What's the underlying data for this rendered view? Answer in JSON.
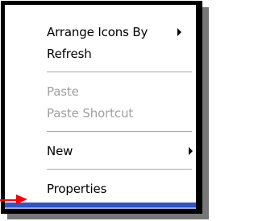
{
  "context_menu": {
    "items": [
      {
        "label": "Arrange Icons By",
        "has_submenu": true,
        "enabled": true
      },
      {
        "label": "Refresh",
        "has_submenu": false,
        "enabled": true
      },
      {
        "label": "Paste",
        "has_submenu": false,
        "enabled": false
      },
      {
        "label": "Paste Shortcut",
        "has_submenu": false,
        "enabled": false
      },
      {
        "label": "New",
        "has_submenu": true,
        "enabled": true
      },
      {
        "label": "Properties",
        "has_submenu": false,
        "enabled": true
      }
    ]
  },
  "colors": {
    "frame": "#000000",
    "menu_accent": "#2f55c8",
    "disabled_text": "#a0a0a0",
    "separator": "#a7a7a7",
    "pointer": "#ff0000"
  },
  "icons": {
    "submenu": "triangle-right-icon",
    "annotation": "red-arrow-icon"
  }
}
